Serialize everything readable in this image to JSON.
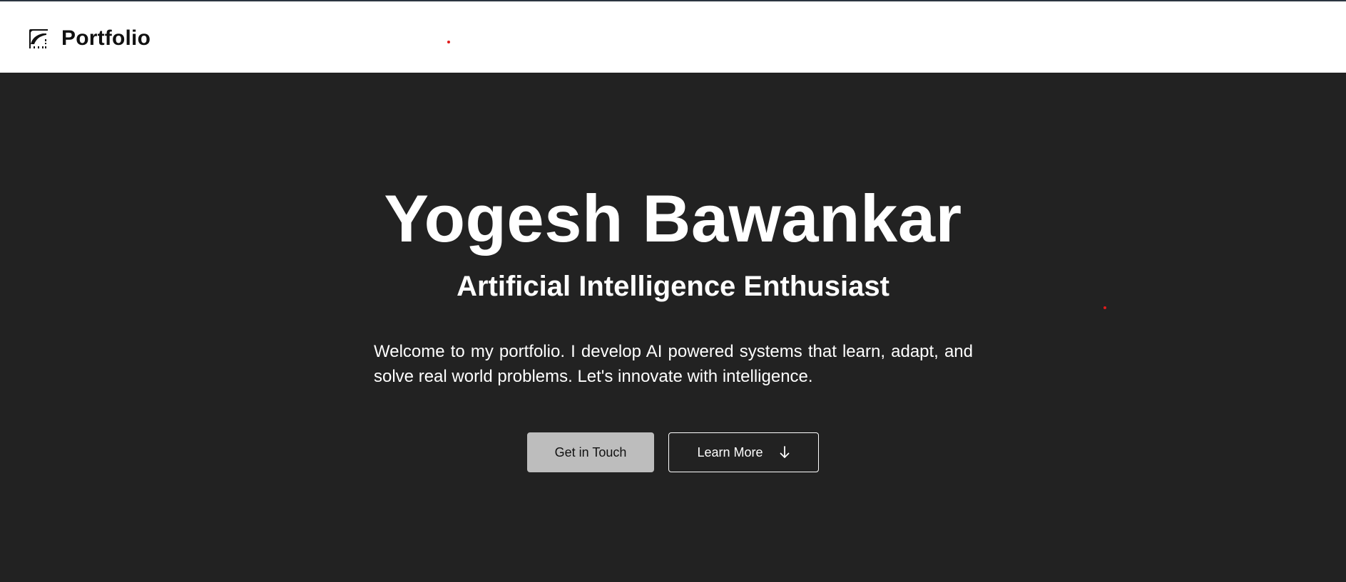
{
  "header": {
    "brand_icon": "portfolio-logo-icon",
    "brand_text": "Portfolio",
    "background": "#ffffff",
    "top_border_color": "#2b3540",
    "cursor_dot_color": "#e01b1b"
  },
  "hero": {
    "background": "#222222",
    "name": "Yogesh Bawankar",
    "title": "Artificial Intelligence Enthusiast",
    "description": "Welcome to my portfolio. I develop AI powered systems that learn, adapt, and solve real world problems. Let's innovate with intelligence.",
    "buttons": {
      "primary_label": "Get in Touch",
      "primary_color": "#bdbdbd",
      "secondary_label": "Learn More",
      "secondary_icon": "arrow-down-icon"
    }
  }
}
